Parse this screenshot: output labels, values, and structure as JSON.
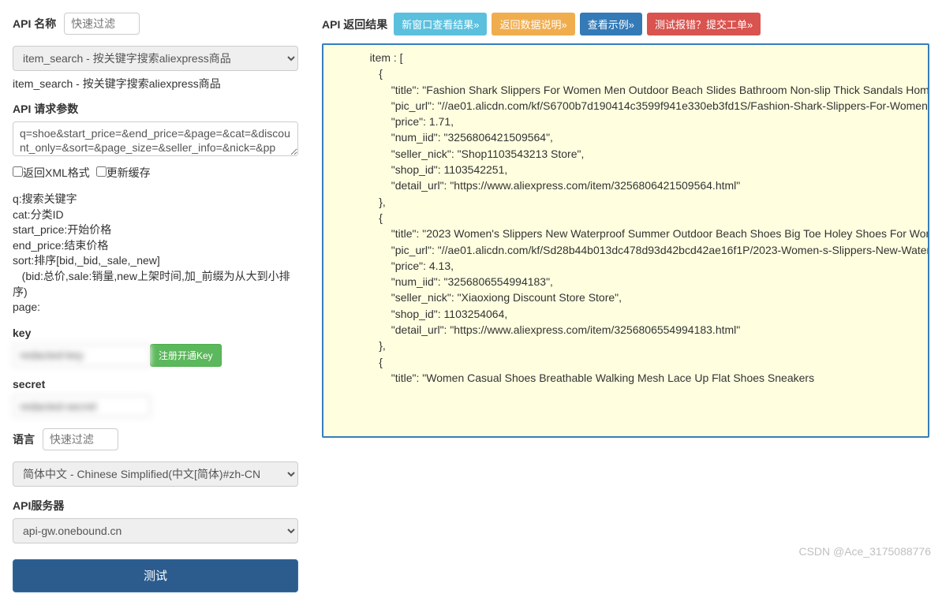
{
  "left": {
    "api_name_label": "API 名称",
    "api_name_placeholder": "快速过滤",
    "api_select_value": "item_search - 按关键字搜索aliexpress商品",
    "api_select_caption": "item_search - 按关键字搜索aliexpress商品",
    "api_params_label": "API 请求参数",
    "api_params_value": "q=shoe&start_price=&end_price=&page=&cat=&discount_only=&sort=&page_size=&seller_info=&nick=&pp",
    "cb_xml_label": "返回XML格式",
    "cb_cache_label": "更新缓存",
    "help": {
      "l1": "q:搜索关键字",
      "l2": "cat:分类ID",
      "l3": "start_price:开始价格",
      "l4": "end_price:结束价格",
      "l5": "sort:排序[bid,_bid,_sale,_new]",
      "l6": "   (bid:总价,sale:销量,new上架时间,加_前缀为从大到小排序)",
      "l7": "page:"
    },
    "key_label": "key",
    "key_value": "redacted-key",
    "key_btn": "注册开通Key",
    "secret_label": "secret",
    "secret_value": "redacted-secret",
    "lang_label": "语言",
    "lang_placeholder": "快速过滤",
    "lang_select_value": "简体中文 - Chinese Simplified(中文[简体)#zh-CN",
    "server_label": "API服务器",
    "server_select_value": "api-gw.onebound.cn",
    "test_btn": "测试"
  },
  "right": {
    "title": "API 返回结果",
    "btn_new_window": "新窗口查看结果»",
    "btn_return_desc": "返回数据说明»",
    "btn_example": "查看示例»",
    "btn_report": "测试报错？提交工单»",
    "json_text": "             item : [\n                {\n                    \"title\": \"Fashion Shark Slippers For Women Men Outdoor Beach Slides Bathroom Non-slip Thick Sandals Home Couple Flat Shoe Shark Flip Flops\",\n                    \"pic_url\": \"//ae01.alicdn.com/kf/S6700b7d190414c3599f941e330eb3fd1S/Fashion-Shark-Slippers-For-Women-Men-Outdoor-Beach-Slides-Bathroom-Non-slip-Thick-Sandals-Home-Couple.jpg_350x350xz.jpg\",\n                    \"price\": 1.71,\n                    \"num_iid\": \"3256806421509564\",\n                    \"seller_nick\": \"Shop1103543213 Store\",\n                    \"shop_id\": 1103542251,\n                    \"detail_url\": \"https://www.aliexpress.com/item/3256806421509564.html\"\n                },\n                {\n                    \"title\": \"2023 Women's Slippers New Waterproof Summer Outdoor Beach Shoes Big Toe Holey Shoes For Women Men Croc Sandals Wrapped Slippers\",\n                    \"pic_url\": \"//ae01.alicdn.com/kf/Sd28b44b013dc478d93d42bcd42ae16f1P/2023-Women-s-Slippers-New-Waterproof-Summer-Outdoor-Beach-Shoes-Big-Toe-Holey-Shoes-For-Women.jpg_350x350xz.jpg\",\n                    \"price\": 4.13,\n                    \"num_iid\": \"3256806554994183\",\n                    \"seller_nick\": \"Xiaoxiong Discount Store Store\",\n                    \"shop_id\": 1103254064,\n                    \"detail_url\": \"https://www.aliexpress.com/item/3256806554994183.html\"\n                },\n                {\n                    \"title\": \"Women Casual Shoes Breathable Walking Mesh Lace Up Flat Shoes Sneakers"
  },
  "watermark": "CSDN @Ace_3175088776"
}
